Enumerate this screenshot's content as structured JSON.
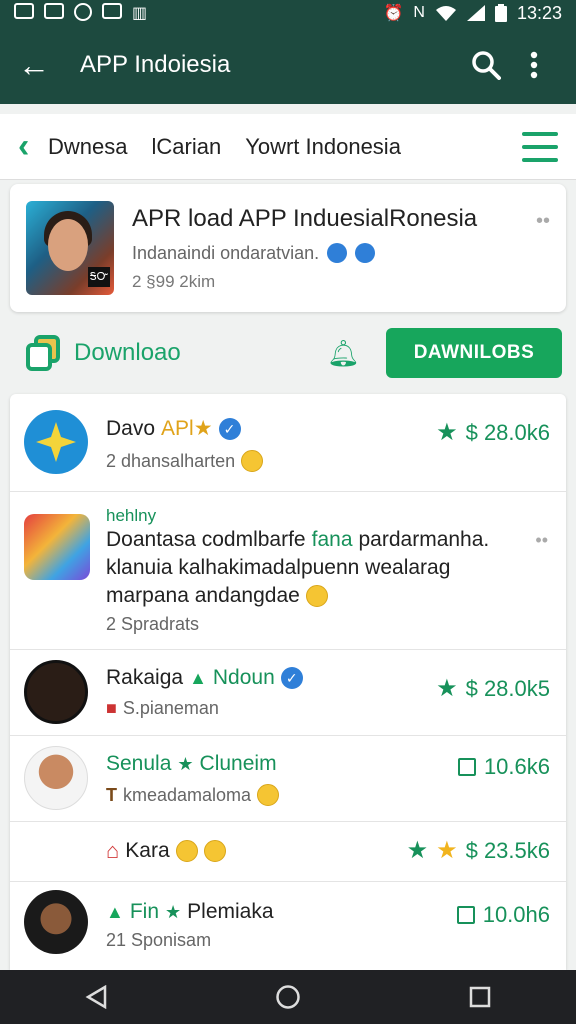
{
  "status_bar": {
    "time": "13:23"
  },
  "app_bar": {
    "title": "APP Indoiesia"
  },
  "tabs": [
    {
      "label": "Dwnesa"
    },
    {
      "label": "lCarian"
    },
    {
      "label": "Yowrt Indonesia"
    }
  ],
  "app_card": {
    "name": "APR load APP InduesialRonesia",
    "subtitle": "Indanaindi ondaratvian.",
    "meta": "2 §99 2kim",
    "thumb_tag": "ᎦᏅ"
  },
  "download_row": {
    "label": "Downloao",
    "button_label": "DAWNILOBS"
  },
  "rows": [
    {
      "name_a": "Davo",
      "name_b": "APl★",
      "sub": "2 dhansalharten",
      "price": "$ 28.0k6"
    },
    {
      "tag": "hehlny",
      "line1_a": "Doantasa codmlbarfe",
      "line1_b": "fana",
      "line1_c": "pardarmanha.",
      "line2": "klanuia kalhakimadalpuenn wealarag",
      "line3": "marpana andangdae",
      "sub": "2 Spradrats"
    },
    {
      "name_a": "Rakaiga",
      "name_b": "Ndoun",
      "sub": "S.pianeman",
      "price": "$ 28.0k5"
    },
    {
      "name_a": "Senula",
      "name_b": "Cluneim",
      "sub": "kmeadamaloma",
      "price": "10.6k6"
    },
    {
      "name_a": "Kara",
      "price": "$ 23.5k6"
    },
    {
      "name_a": "Fin",
      "name_b": "Plemiaka",
      "sub": "21 Sponisam",
      "price": "10.0h6"
    }
  ],
  "colors": {
    "header": "#1d4a3f",
    "accent": "#1aa36a",
    "button": "#17a65c"
  }
}
